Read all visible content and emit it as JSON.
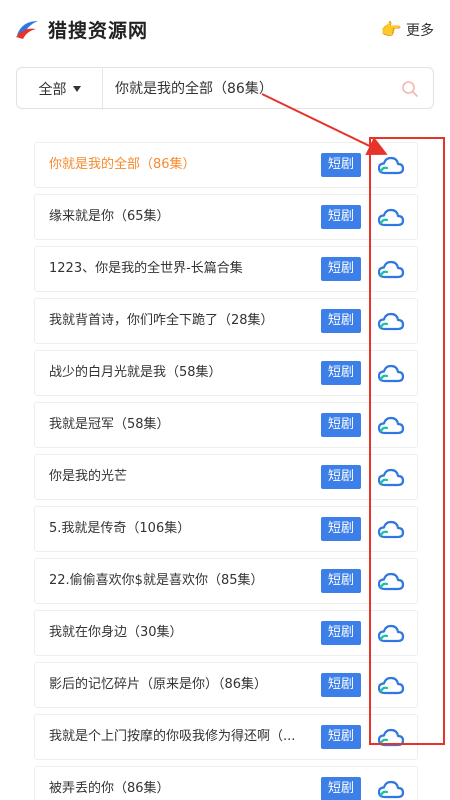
{
  "header": {
    "logo_icon": "logo-swirl-icon",
    "title": "猎搜资源网",
    "more_icon": "pointing-hand-icon",
    "more_label": "更多"
  },
  "search": {
    "category": "全部",
    "query": "你就是我的全部（86集）",
    "button_icon": "search-icon"
  },
  "results": [
    {
      "title": "你就是我的全部（86集）",
      "tag": "短剧",
      "active": true
    },
    {
      "title": "缘来就是你（65集）",
      "tag": "短剧"
    },
    {
      "title": "1223、你是我的全世界-长篇合集",
      "tag": "短剧"
    },
    {
      "title": "我就背首诗，你们咋全下跪了（28集）",
      "tag": "短剧"
    },
    {
      "title": "战少的白月光就是我（58集）",
      "tag": "短剧"
    },
    {
      "title": "我就是冠军（58集）",
      "tag": "短剧"
    },
    {
      "title": "你是我的光芒",
      "tag": "短剧"
    },
    {
      "title": "5.我就是传奇（106集）",
      "tag": "短剧"
    },
    {
      "title": "22.偷偷喜欢你$就是喜欢你（85集）",
      "tag": "短剧"
    },
    {
      "title": "我就在你身边（30集）",
      "tag": "短剧"
    },
    {
      "title": "影后的记忆碎片（原来是你）（86集）",
      "tag": "短剧"
    },
    {
      "title": "我就是个上门按摩的你吸我修为得还啊（...",
      "tag": "短剧"
    },
    {
      "title": "被弄丢的你（86集）",
      "tag": "短剧"
    }
  ],
  "row_icon": "cloud-drive-icon",
  "colors": {
    "accent_blue": "#3d7fe8",
    "active_orange": "#f58a2f",
    "annotation_red": "#e8332a"
  }
}
